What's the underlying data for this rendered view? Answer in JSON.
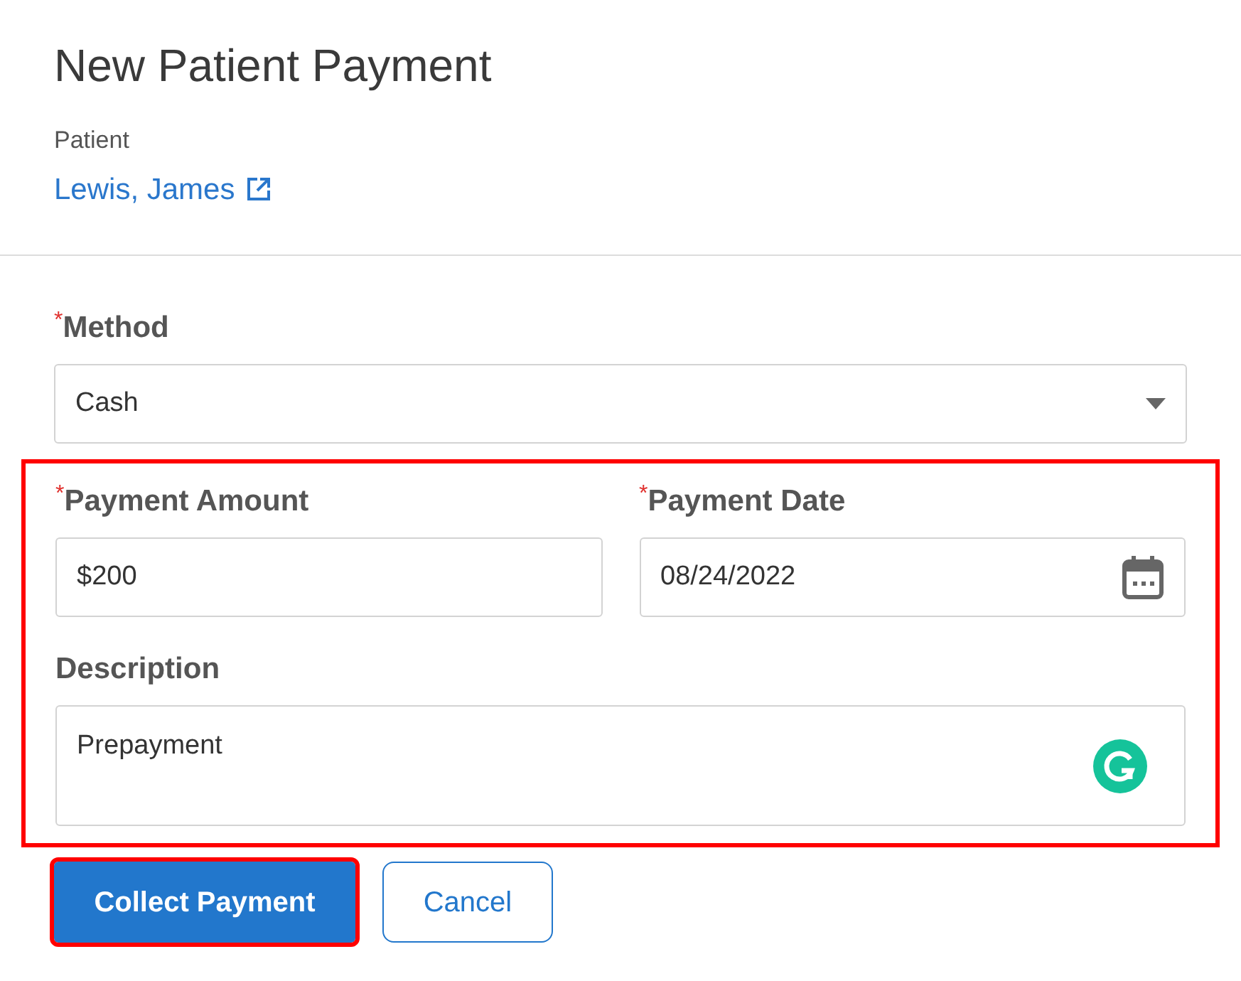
{
  "title": "New Patient Payment",
  "patient": {
    "label": "Patient",
    "name": "Lewis, James"
  },
  "method": {
    "label": "Method",
    "required_mark": "*",
    "value": "Cash"
  },
  "highlighted_group": {
    "highlighted": true,
    "amount": {
      "label": "Payment Amount",
      "required_mark": "*",
      "value": "$200"
    },
    "date": {
      "label": "Payment Date",
      "required_mark": "*",
      "value": "08/24/2022"
    },
    "description": {
      "label": "Description",
      "value": "Prepayment"
    }
  },
  "buttons": [
    {
      "label": "Collect Payment",
      "kind": "primary",
      "highlighted": true
    },
    {
      "label": "Cancel",
      "kind": "secondary",
      "highlighted": false
    }
  ]
}
